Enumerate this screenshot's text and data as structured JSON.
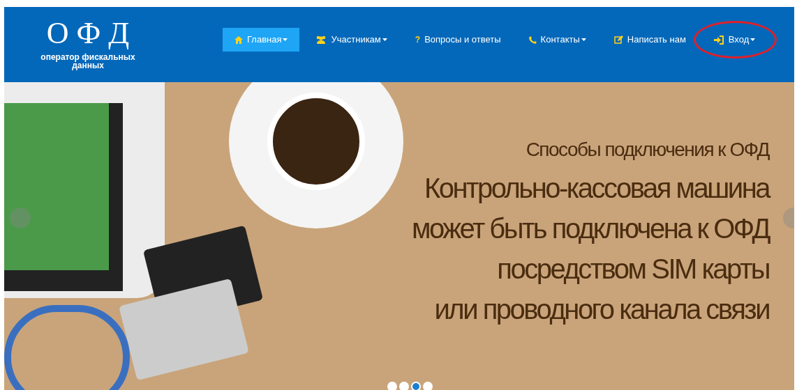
{
  "logo": {
    "title": "О Ф Д",
    "subtitle": "оператор фискальных данных"
  },
  "nav": [
    {
      "label": "Главная",
      "kind": "home",
      "dropdown": true,
      "selected": true,
      "circled": false
    },
    {
      "label": "Участникам",
      "kind": "users",
      "dropdown": true,
      "selected": false,
      "circled": false
    },
    {
      "label": "Вопросы и ответы",
      "kind": "question",
      "glyph": "?",
      "dropdown": false,
      "selected": false,
      "circled": false
    },
    {
      "label": "Контакты",
      "kind": "phone",
      "dropdown": true,
      "selected": false,
      "circled": false
    },
    {
      "label": "Написать нам",
      "kind": "edit",
      "dropdown": false,
      "selected": false,
      "circled": false
    },
    {
      "label": "Вход",
      "kind": "signin",
      "dropdown": true,
      "selected": false,
      "circled": true
    }
  ],
  "slider": {
    "caption": [
      {
        "kind": "small",
        "text": "Способы подключения к ОФД"
      },
      {
        "kind": "large",
        "text": "Контрольно-кассовая машина"
      },
      {
        "kind": "large",
        "text": "может быть подключена к ОФД"
      },
      {
        "kind": "large",
        "text": "посредством SIM карты"
      },
      {
        "kind": "large",
        "text": "или проводного канала связи"
      }
    ],
    "dots": [
      {
        "selected": false
      },
      {
        "selected": false
      },
      {
        "selected": true
      },
      {
        "selected": false
      }
    ]
  }
}
